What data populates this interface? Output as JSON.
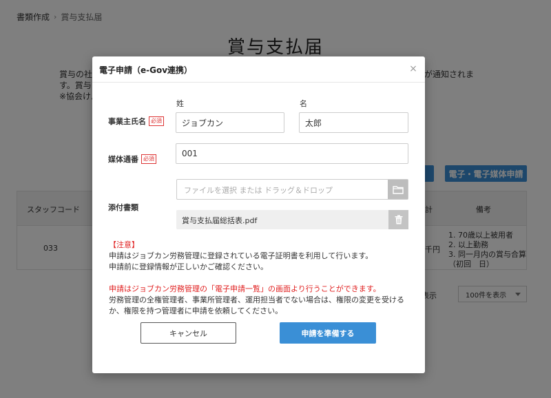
{
  "breadcrumb": {
    "parent": "書類作成",
    "current": "賞与支払届"
  },
  "page": {
    "title": "賞与支払届",
    "intro_line1_left": "賞与の社会",
    "intro_line1_right": "が通知されま",
    "intro_line2": "す。賞与了",
    "intro_line3": "※協会けん"
  },
  "bg_buttons": {
    "egov_label": "電子・電子媒体申請"
  },
  "bg_table": {
    "headers": {
      "staff_code": "スタッフコード",
      "total": "計",
      "note": "備考"
    },
    "row": {
      "staff_code": "033",
      "amount_frag": "千円",
      "notes": [
        "1. 70歳以上被用者",
        "2. 以上勤務",
        "3. 同一月内の賞与合算",
        "（初回　日）"
      ]
    },
    "pager_label": "表示",
    "per_page": "100件を表示"
  },
  "modal": {
    "title": "電子申請（e-Gov連携）",
    "close_glyph": "×",
    "required_badge": "必須",
    "owner": {
      "label": "事業主氏名",
      "last_label": "姓",
      "first_label": "名",
      "last_value": "ジョブカン",
      "first_value": "太郎"
    },
    "media": {
      "label": "媒体通番",
      "value": "001"
    },
    "attachment": {
      "label": "添付書類",
      "placeholder": "ファイルを選択 または ドラッグ＆ドロップ",
      "file_name": "賞与支払届総括表.pdf"
    },
    "notes": {
      "heading": "【注意】",
      "line1": "申請はジョブカン労務管理に登録されている電子証明書を利用して行います。",
      "line2": "申請前に登録情報が正しいかご確認ください。",
      "line3": "申請はジョブカン労務管理の「電子申請一覧」の画面より行うことができます。",
      "line4": "労務管理の全権管理者、事業所管理者、運用担当者でない場合は、権限の変更を受ける",
      "line5": "か、権限を持つ管理者に申請を依頼してください。"
    },
    "buttons": {
      "cancel": "キャンセル",
      "prepare": "申請を準備する"
    }
  },
  "colors": {
    "primary": "#3a8fd6",
    "required": "#d33333",
    "notice_red": "#e02020"
  }
}
